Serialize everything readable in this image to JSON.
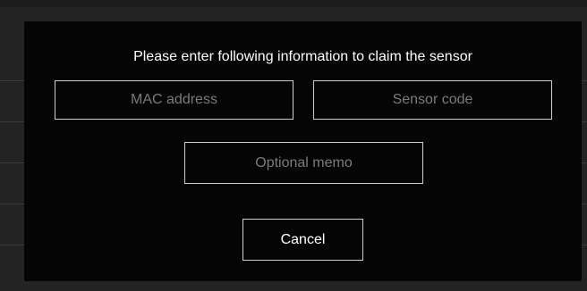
{
  "dialog": {
    "title": "Please enter following information to claim the sensor",
    "fields": {
      "mac_address": {
        "placeholder": "MAC address",
        "value": ""
      },
      "sensor_code": {
        "placeholder": "Sensor code",
        "value": ""
      },
      "memo": {
        "placeholder": "Optional memo",
        "value": ""
      }
    },
    "cancel_label": "Cancel"
  },
  "colors": {
    "backdrop": "#232323",
    "modal_background": "#050505",
    "border": "#cfcfcf",
    "placeholder": "#7b7b7b",
    "text": "#ffffff"
  }
}
